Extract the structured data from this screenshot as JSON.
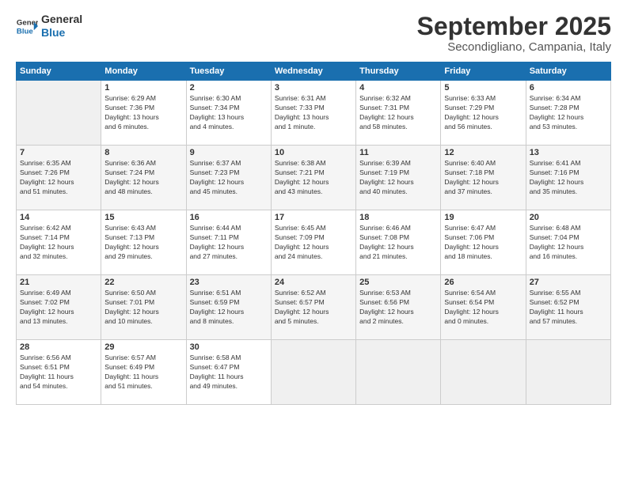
{
  "header": {
    "logo_line1": "General",
    "logo_line2": "Blue",
    "month": "September 2025",
    "location": "Secondigliano, Campania, Italy"
  },
  "columns": [
    "Sunday",
    "Monday",
    "Tuesday",
    "Wednesday",
    "Thursday",
    "Friday",
    "Saturday"
  ],
  "weeks": [
    [
      {
        "day": "",
        "info": ""
      },
      {
        "day": "1",
        "info": "Sunrise: 6:29 AM\nSunset: 7:36 PM\nDaylight: 13 hours\nand 6 minutes."
      },
      {
        "day": "2",
        "info": "Sunrise: 6:30 AM\nSunset: 7:34 PM\nDaylight: 13 hours\nand 4 minutes."
      },
      {
        "day": "3",
        "info": "Sunrise: 6:31 AM\nSunset: 7:33 PM\nDaylight: 13 hours\nand 1 minute."
      },
      {
        "day": "4",
        "info": "Sunrise: 6:32 AM\nSunset: 7:31 PM\nDaylight: 12 hours\nand 58 minutes."
      },
      {
        "day": "5",
        "info": "Sunrise: 6:33 AM\nSunset: 7:29 PM\nDaylight: 12 hours\nand 56 minutes."
      },
      {
        "day": "6",
        "info": "Sunrise: 6:34 AM\nSunset: 7:28 PM\nDaylight: 12 hours\nand 53 minutes."
      }
    ],
    [
      {
        "day": "7",
        "info": "Sunrise: 6:35 AM\nSunset: 7:26 PM\nDaylight: 12 hours\nand 51 minutes."
      },
      {
        "day": "8",
        "info": "Sunrise: 6:36 AM\nSunset: 7:24 PM\nDaylight: 12 hours\nand 48 minutes."
      },
      {
        "day": "9",
        "info": "Sunrise: 6:37 AM\nSunset: 7:23 PM\nDaylight: 12 hours\nand 45 minutes."
      },
      {
        "day": "10",
        "info": "Sunrise: 6:38 AM\nSunset: 7:21 PM\nDaylight: 12 hours\nand 43 minutes."
      },
      {
        "day": "11",
        "info": "Sunrise: 6:39 AM\nSunset: 7:19 PM\nDaylight: 12 hours\nand 40 minutes."
      },
      {
        "day": "12",
        "info": "Sunrise: 6:40 AM\nSunset: 7:18 PM\nDaylight: 12 hours\nand 37 minutes."
      },
      {
        "day": "13",
        "info": "Sunrise: 6:41 AM\nSunset: 7:16 PM\nDaylight: 12 hours\nand 35 minutes."
      }
    ],
    [
      {
        "day": "14",
        "info": "Sunrise: 6:42 AM\nSunset: 7:14 PM\nDaylight: 12 hours\nand 32 minutes."
      },
      {
        "day": "15",
        "info": "Sunrise: 6:43 AM\nSunset: 7:13 PM\nDaylight: 12 hours\nand 29 minutes."
      },
      {
        "day": "16",
        "info": "Sunrise: 6:44 AM\nSunset: 7:11 PM\nDaylight: 12 hours\nand 27 minutes."
      },
      {
        "day": "17",
        "info": "Sunrise: 6:45 AM\nSunset: 7:09 PM\nDaylight: 12 hours\nand 24 minutes."
      },
      {
        "day": "18",
        "info": "Sunrise: 6:46 AM\nSunset: 7:08 PM\nDaylight: 12 hours\nand 21 minutes."
      },
      {
        "day": "19",
        "info": "Sunrise: 6:47 AM\nSunset: 7:06 PM\nDaylight: 12 hours\nand 18 minutes."
      },
      {
        "day": "20",
        "info": "Sunrise: 6:48 AM\nSunset: 7:04 PM\nDaylight: 12 hours\nand 16 minutes."
      }
    ],
    [
      {
        "day": "21",
        "info": "Sunrise: 6:49 AM\nSunset: 7:02 PM\nDaylight: 12 hours\nand 13 minutes."
      },
      {
        "day": "22",
        "info": "Sunrise: 6:50 AM\nSunset: 7:01 PM\nDaylight: 12 hours\nand 10 minutes."
      },
      {
        "day": "23",
        "info": "Sunrise: 6:51 AM\nSunset: 6:59 PM\nDaylight: 12 hours\nand 8 minutes."
      },
      {
        "day": "24",
        "info": "Sunrise: 6:52 AM\nSunset: 6:57 PM\nDaylight: 12 hours\nand 5 minutes."
      },
      {
        "day": "25",
        "info": "Sunrise: 6:53 AM\nSunset: 6:56 PM\nDaylight: 12 hours\nand 2 minutes."
      },
      {
        "day": "26",
        "info": "Sunrise: 6:54 AM\nSunset: 6:54 PM\nDaylight: 12 hours\nand 0 minutes."
      },
      {
        "day": "27",
        "info": "Sunrise: 6:55 AM\nSunset: 6:52 PM\nDaylight: 11 hours\nand 57 minutes."
      }
    ],
    [
      {
        "day": "28",
        "info": "Sunrise: 6:56 AM\nSunset: 6:51 PM\nDaylight: 11 hours\nand 54 minutes."
      },
      {
        "day": "29",
        "info": "Sunrise: 6:57 AM\nSunset: 6:49 PM\nDaylight: 11 hours\nand 51 minutes."
      },
      {
        "day": "30",
        "info": "Sunrise: 6:58 AM\nSunset: 6:47 PM\nDaylight: 11 hours\nand 49 minutes."
      },
      {
        "day": "",
        "info": ""
      },
      {
        "day": "",
        "info": ""
      },
      {
        "day": "",
        "info": ""
      },
      {
        "day": "",
        "info": ""
      }
    ]
  ]
}
